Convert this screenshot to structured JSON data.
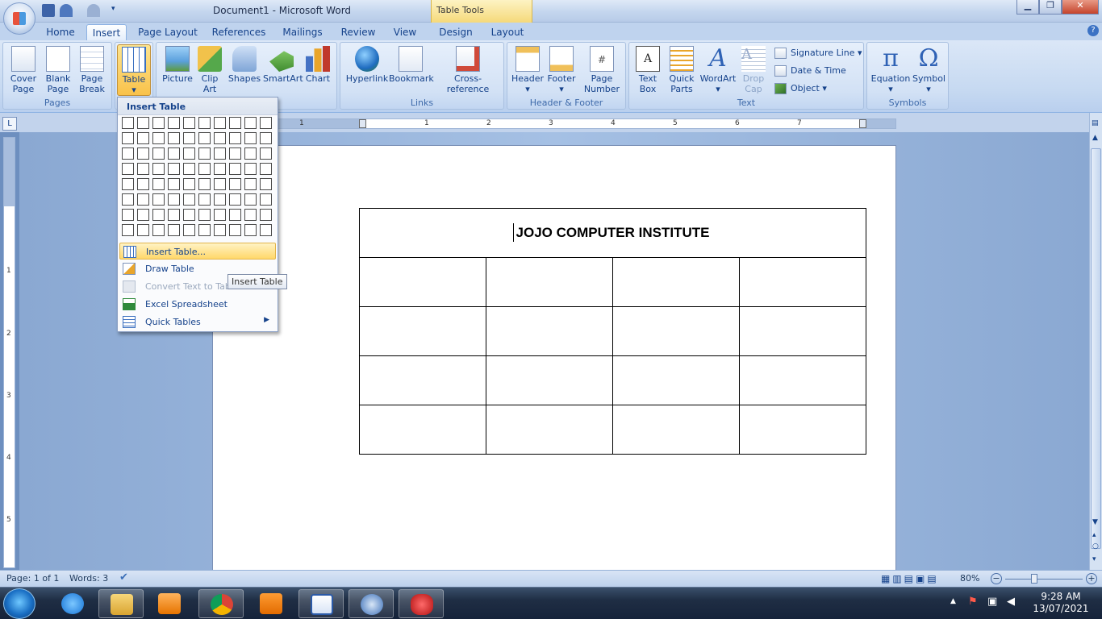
{
  "window": {
    "title": "Document1 - Microsoft Word",
    "context_tab": "Table Tools"
  },
  "tabs": [
    "Home",
    "Insert",
    "Page Layout",
    "References",
    "Mailings",
    "Review",
    "View",
    "Design",
    "Layout"
  ],
  "active_tab": "Insert",
  "ribbon": {
    "pages": {
      "label": "Pages",
      "cover": "Cover\nPage",
      "blank": "Blank\nPage",
      "break": "Page\nBreak"
    },
    "tables": {
      "table": "Table"
    },
    "illustrations": {
      "picture": "Picture",
      "clip": "Clip\nArt",
      "shapes": "Shapes",
      "smartart": "SmartArt",
      "chart": "Chart"
    },
    "links": {
      "label": "Links",
      "hyperlink": "Hyperlink",
      "bookmark": "Bookmark",
      "crossref": "Cross-reference"
    },
    "hf": {
      "label": "Header & Footer",
      "header": "Header",
      "footer": "Footer",
      "pagenum": "Page\nNumber"
    },
    "text": {
      "label": "Text",
      "textbox": "Text\nBox",
      "quickparts": "Quick\nParts",
      "wordart": "WordArt",
      "dropcap": "Drop\nCap",
      "sigline": "Signature Line",
      "datetime": "Date & Time",
      "object": "Object"
    },
    "symbols": {
      "label": "Symbols",
      "equation": "Equation",
      "symbol": "Symbol"
    }
  },
  "menu": {
    "header": "Insert Table",
    "items": {
      "insert_table": "Insert Table...",
      "draw_table": "Draw Table",
      "convert": "Convert Text to Table",
      "excel": "Excel Spreadsheet",
      "quick_tables": "Quick Tables"
    },
    "grid_cols": 10,
    "grid_rows": 8
  },
  "tooltip": "Insert Table",
  "ruler": {
    "h_numbers": [
      "1",
      "1",
      "2",
      "3",
      "4",
      "5",
      "6",
      "7"
    ],
    "v_numbers": [
      "1",
      "1",
      "2",
      "3",
      "4",
      "5"
    ]
  },
  "document": {
    "table_title": "JOJO COMPUTER  INSTITUTE",
    "table_rows": 4,
    "table_cols": 4
  },
  "status": {
    "page": "Page: 1 of 1",
    "words": "Words: 3",
    "zoom": "80%"
  },
  "clock": {
    "time": "9:28 AM",
    "date": "13/07/2021"
  },
  "colors": {
    "accent": "#15428b",
    "ribbon": "#c6d9f1",
    "selected": "#f9c24a"
  }
}
